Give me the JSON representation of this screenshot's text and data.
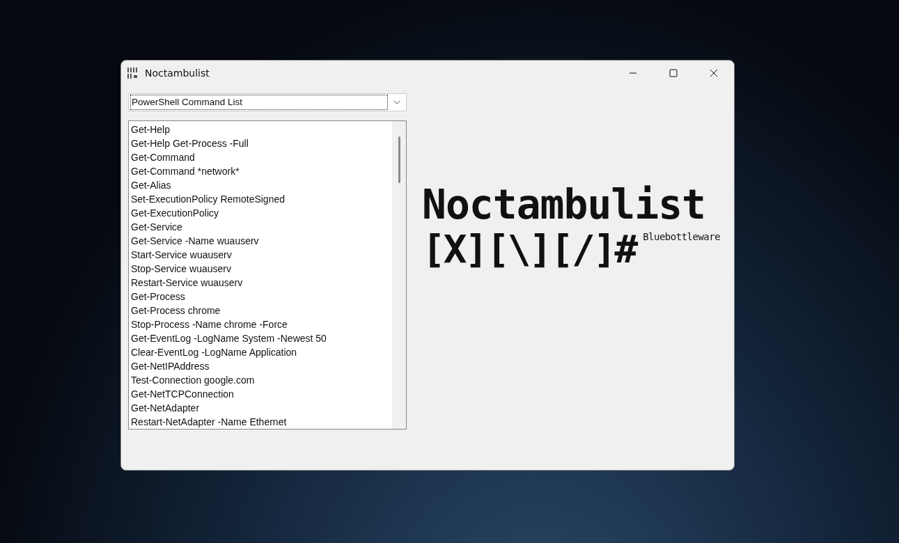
{
  "window": {
    "title": "Noctambulist"
  },
  "dropdown": {
    "value": "PowerShell Command List"
  },
  "commands": [
    "Get-Help",
    "Get-Help Get-Process -Full",
    "Get-Command",
    "Get-Command *network*",
    "Get-Alias",
    "Set-ExecutionPolicy RemoteSigned",
    "Get-ExecutionPolicy",
    "Get-Service",
    "Get-Service -Name wuauserv",
    "Start-Service wuauserv",
    "Stop-Service wuauserv",
    "Restart-Service wuauserv",
    "Get-Process",
    "Get-Process chrome",
    "Stop-Process -Name chrome -Force",
    "Get-EventLog -LogName System -Newest 50",
    "Clear-EventLog -LogName Application",
    "Get-NetIPAddress",
    "Test-Connection google.com",
    "Get-NetTCPConnection",
    "Get-NetAdapter",
    "Restart-NetAdapter -Name Ethernet"
  ],
  "logo": {
    "name": "Noctambulist",
    "symbol": "[X][\\][/]#",
    "maker": "Bluebottleware"
  }
}
